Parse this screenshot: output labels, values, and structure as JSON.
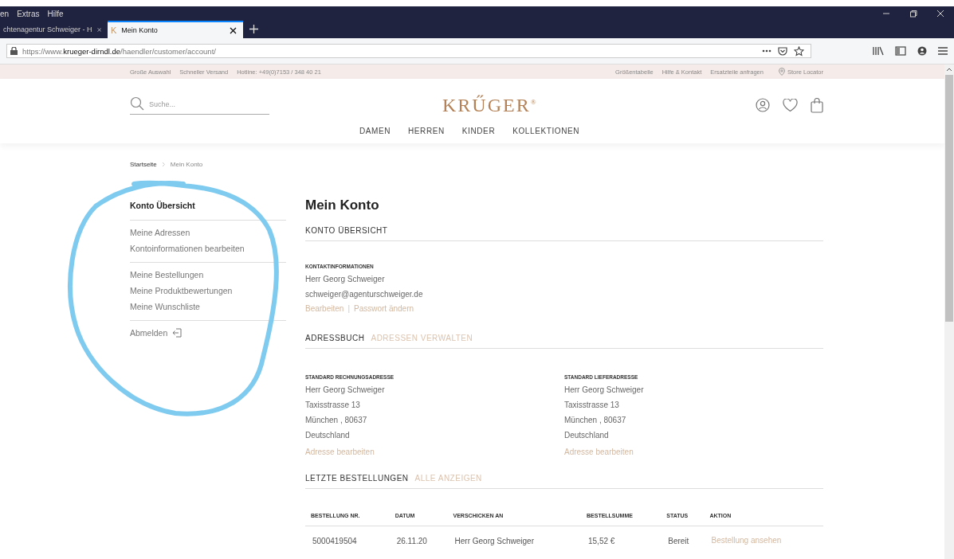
{
  "browser": {
    "menu": [
      "en",
      "Extras",
      "Hilfe"
    ],
    "tabs": [
      {
        "label": "chtenagentur Schweiger - H",
        "selected": false
      },
      {
        "label": "Mein Konto",
        "selected": true,
        "favicon": "K"
      }
    ],
    "url": {
      "domain_prefix": "https://www.",
      "domain": "krueger-dirndl.de",
      "path": "/haendler/customer/account/"
    }
  },
  "topbar": {
    "left": [
      "Große Auswahl",
      "Schneller Versand",
      "Hotline: +49(0)7153 / 348 40 21"
    ],
    "right": [
      "Größentabelle",
      "Hilfe & Kontakt",
      "Ersatzteile anfragen"
    ],
    "store_locator": "Store Locator"
  },
  "header": {
    "search": {
      "placeholder": "Suche..."
    },
    "logo": "KRŰGER",
    "logo_mark": "®",
    "nav": [
      "DAMEN",
      "HERREN",
      "KINDER",
      "KOLLEKTIONEN"
    ]
  },
  "breadcrumbs": [
    {
      "label": "Startseite",
      "selected": false
    },
    {
      "label": "Mein Konto",
      "selected": true
    }
  ],
  "sidebar": {
    "groups": [
      [
        {
          "label": "Konto Übersicht",
          "selected": true
        }
      ],
      [
        {
          "label": "Meine Adressen",
          "selected": false
        },
        {
          "label": "Kontoinformationen bearbeiten",
          "selected": false
        }
      ],
      [
        {
          "label": "Meine Bestellungen",
          "selected": false
        },
        {
          "label": "Meine Produktbewertungen",
          "selected": false
        },
        {
          "label": "Meine Wunschliste",
          "selected": false
        }
      ]
    ],
    "logout": "Abmelden"
  },
  "main": {
    "title": "Mein Konto",
    "overview_heading": "KONTO ÜBERSICHT",
    "contact": {
      "heading": "KONTAKTINFORMATIONEN",
      "lines": [
        "Herr Georg Schweiger",
        "schweiger@agenturschweiger.de"
      ],
      "links": [
        "Bearbeiten",
        "Passwort ändern"
      ],
      "separator": "|"
    },
    "addressbook": {
      "heading": "ADRESSBUCH",
      "link": "ADRESSEN VERWALTEN",
      "addresses": [
        {
          "heading": "STANDARD RECHNUNGSADRESSE",
          "lines": [
            "Herr Georg Schweiger",
            "Taxisstrasse 13",
            "München , 80637",
            "Deutschland"
          ],
          "link": "Adresse bearbeiten"
        },
        {
          "heading": "STANDARD LIEFERADRESSE",
          "lines": [
            "Herr Georg Schweiger",
            "Taxisstrasse 13",
            "München , 80637",
            "Deutschland"
          ],
          "link": "Adresse bearbeiten"
        }
      ]
    },
    "orders": {
      "heading": "LETZTE BESTELLUNGEN",
      "link": "ALLE ANZEIGEN",
      "columns": [
        "BESTELLUNG NR.",
        "DATUM",
        "VERSCHICKEN AN",
        "BESTELLSUMME",
        "STATUS",
        "AKTION"
      ],
      "rows": [
        {
          "cells": [
            "5000419504",
            "26.11.20",
            "Herr Georg Schweiger",
            "15,52 €",
            "Bereit"
          ],
          "action": "Bestellung ansehen"
        }
      ]
    }
  }
}
